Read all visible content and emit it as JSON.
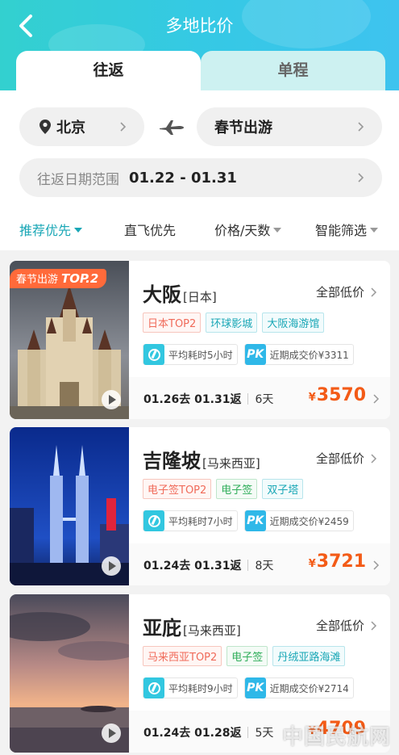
{
  "header": {
    "title": "多地比价",
    "tabs": [
      {
        "label": "往返",
        "active": true
      },
      {
        "label": "单程",
        "active": false
      }
    ]
  },
  "search": {
    "origin": "北京",
    "destination": "春节出游",
    "date_range_label": "往返日期范围",
    "date_range_value": "01.22 - 01.31"
  },
  "sort_options": [
    {
      "label": "推荐优先",
      "active": true,
      "has_arrow": true
    },
    {
      "label": "直飞优先",
      "active": false,
      "has_arrow": false
    },
    {
      "label": "价格/天数",
      "active": false,
      "has_arrow": true
    },
    {
      "label": "智能筛选",
      "active": false,
      "has_arrow": true
    }
  ],
  "cards": [
    {
      "badge_text": "春节出游",
      "badge_rank": "TOP.2",
      "city": "大阪",
      "country": "[日本]",
      "all_low_price": "全部低价",
      "tags": [
        {
          "text": "日本TOP2",
          "style": "red"
        },
        {
          "text": "环球影城",
          "style": "teal"
        },
        {
          "text": "大阪海游馆",
          "style": "teal"
        }
      ],
      "avg_time": "平均耗时5小时",
      "pk_label": "PK",
      "recent_price": "近期成交价¥3311",
      "dates": "01.26去 01.31返",
      "days": "6天",
      "currency": "¥",
      "price": "3570"
    },
    {
      "city": "吉隆坡",
      "country": "[马来西亚]",
      "all_low_price": "全部低价",
      "tags": [
        {
          "text": "电子签TOP2",
          "style": "red"
        },
        {
          "text": "电子签",
          "style": "green"
        },
        {
          "text": "双子塔",
          "style": "teal"
        }
      ],
      "avg_time": "平均耗时7小时",
      "pk_label": "PK",
      "recent_price": "近期成交价¥2459",
      "dates": "01.24去 01.31返",
      "days": "8天",
      "currency": "¥",
      "price": "3721"
    },
    {
      "city": "亚庇",
      "country": "[马来西亚]",
      "all_low_price": "全部低价",
      "tags": [
        {
          "text": "马来西亚TOP2",
          "style": "red"
        },
        {
          "text": "电子签",
          "style": "green"
        },
        {
          "text": "丹绒亚路海滩",
          "style": "teal"
        }
      ],
      "avg_time": "平均耗时9小时",
      "pk_label": "PK",
      "recent_price": "近期成交价¥2714",
      "dates": "01.24去 01.28返",
      "days": "5天",
      "currency": "¥",
      "price": "4709"
    }
  ],
  "watermark": "中国民航网",
  "colors": {
    "accent": "#1aa7b6",
    "price": "#f35b17",
    "header_start": "#33d0cf",
    "header_end": "#3ec3ef"
  }
}
